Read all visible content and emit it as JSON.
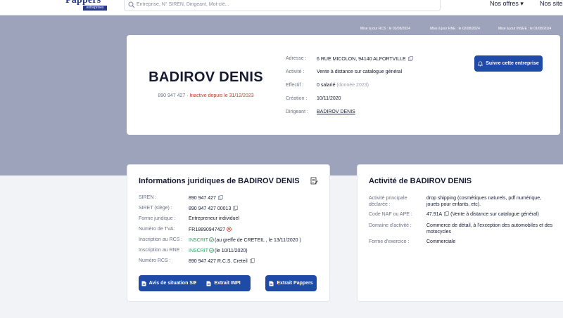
{
  "nav": {
    "logo_word": "Pappers",
    "logo_sub": "entreprises",
    "search_placeholder": "Entreprise, N° SIREN, Dirigeant, Mot-clé...",
    "offres": "Nos offres",
    "sites": "Nos sites"
  },
  "updates": {
    "rcs": "Mise à jour RCS : le 02/08/2024",
    "rne": "Mise à jour RNE : le 02/08/2024",
    "insee": "Mise à jour INSEE : le 01/08/2024"
  },
  "company": {
    "name": "BADIROV DENIS",
    "siren": "890 947 427",
    "status": "· Inactive depuis le 31/12/2023",
    "follow_button": "Suivre cette entreprise",
    "details": {
      "adresse_label": "Adresse :",
      "adresse_value": "6 RUE MICOLON, 94140 ALFORTVILLE",
      "activite_label": "Activité :",
      "activite_value": "Vente à distance sur catalogue général",
      "effectif_label": "Effectif :",
      "effectif_value": "0 salarié",
      "effectif_note": "(donnée 2023)",
      "creation_label": "Création :",
      "creation_value": "10/11/2020",
      "dirigeant_label": "Dirigeant :",
      "dirigeant_value": "BADIROV DENIS"
    }
  },
  "legal": {
    "title": "Informations juridiques de BADIROV DENIS",
    "rows": [
      {
        "label": "SIREN :",
        "value": "890 947 427"
      },
      {
        "label": "SIRET (siège) :",
        "value": "890 947 427 00013"
      },
      {
        "label": "Forme juridique :",
        "value": "Entrepreneur individuel"
      },
      {
        "label": "Numéro de TVA:",
        "value": "FR18890947427"
      },
      {
        "label": "Inscription au RCS :",
        "status": "INSCRIT",
        "value": "(au greffe de CRETEIL , le 13/11/2020 )"
      },
      {
        "label": "Inscription au RNE :",
        "status": "INSCRIT",
        "value": "(le 10/11/2020)"
      },
      {
        "label": "Numéro RCS :",
        "value": "890 947 427 R.C.S. Creteil"
      }
    ],
    "buttons": {
      "sirene": "Avis de situation SIRENE",
      "inpi": "Extrait INPI",
      "pappers": "Extrait Pappers"
    }
  },
  "activity": {
    "title": "Activité de BADIROV DENIS",
    "rows": [
      {
        "label": "Activité principale déclarée :",
        "value": "drop shipping (cosmétiques naturels, pdf numérique, jouets pour enfants, etc)."
      },
      {
        "label": "Code NAF ou APE :",
        "code": "47.91A",
        "value": "(Vente à distance sur catalogue général)"
      },
      {
        "label": "Domaine d'activité :",
        "value": "Commerce de détail, à l'exception des automobiles et des motocycles"
      },
      {
        "label": "Forme d'exercice :",
        "value": "Commerciale"
      }
    ]
  },
  "colors": {
    "primary": "#1f4aa8",
    "band": "#9da3bb",
    "inactive": "#c0392b",
    "inscrit": "#2f9e62"
  }
}
